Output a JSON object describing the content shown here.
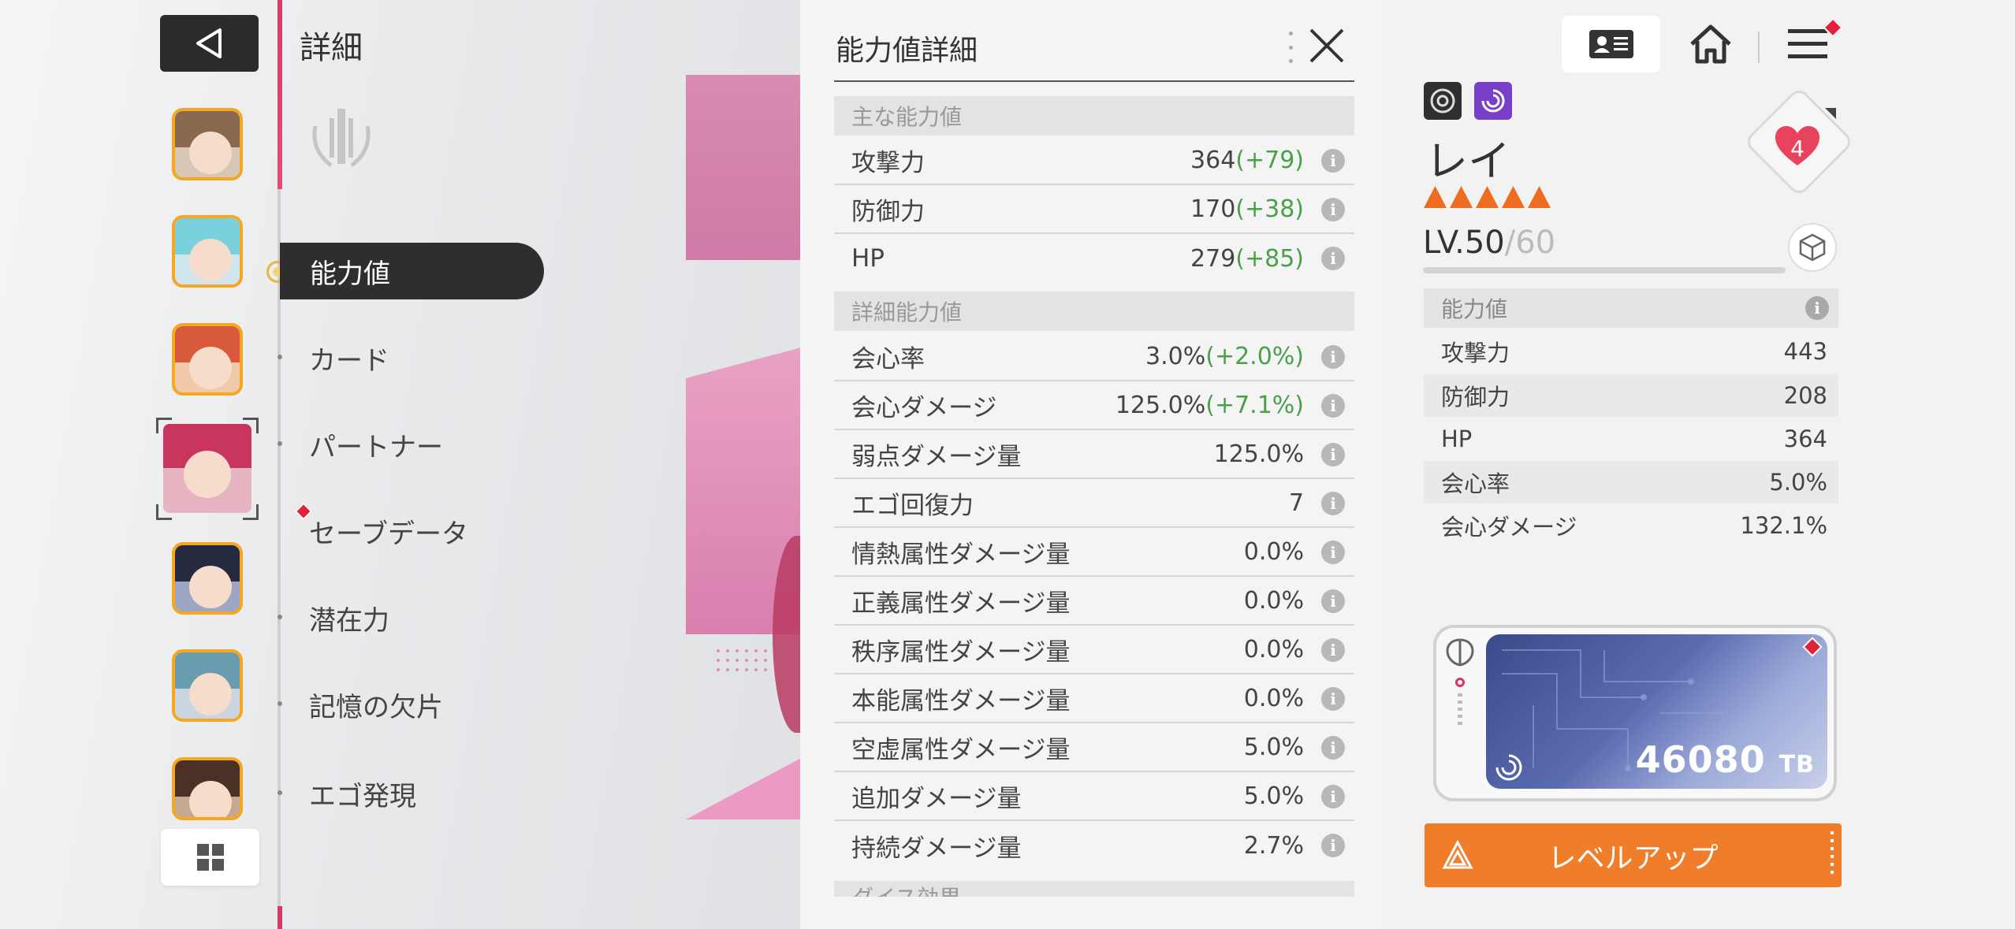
{
  "nav": {
    "title": "詳細",
    "menu": [
      {
        "label": "能力値",
        "active": true
      },
      {
        "label": "カード"
      },
      {
        "label": "パートナー"
      },
      {
        "label": "セーブデータ",
        "badge": "red-diamond"
      },
      {
        "label": "潜在力"
      },
      {
        "label": "記憶の欠片"
      },
      {
        "label": "エゴ発現"
      }
    ]
  },
  "panel": {
    "title": "能力値詳細",
    "main_section": "主な能力値",
    "main_stats": [
      {
        "label": "攻撃力",
        "value": "364",
        "bonus": "(+79)"
      },
      {
        "label": "防御力",
        "value": "170",
        "bonus": "(+38)"
      },
      {
        "label": "HP",
        "value": "279",
        "bonus": "(+85)"
      }
    ],
    "detail_section": "詳細能力値",
    "detail_stats": [
      {
        "label": "会心率",
        "value": "3.0%",
        "bonus": "(+2.0%)"
      },
      {
        "label": "会心ダメージ",
        "value": "125.0%",
        "bonus": "(+7.1%)"
      },
      {
        "label": "弱点ダメージ量",
        "value": "125.0%",
        "bonus": ""
      },
      {
        "label": "エゴ回復力",
        "value": "7",
        "bonus": ""
      },
      {
        "label": "情熱属性ダメージ量",
        "value": "0.0%",
        "bonus": ""
      },
      {
        "label": "正義属性ダメージ量",
        "value": "0.0%",
        "bonus": ""
      },
      {
        "label": "秩序属性ダメージ量",
        "value": "0.0%",
        "bonus": ""
      },
      {
        "label": "本能属性ダメージ量",
        "value": "0.0%",
        "bonus": ""
      },
      {
        "label": "空虚属性ダメージ量",
        "value": "5.0%",
        "bonus": ""
      },
      {
        "label": "追加ダメージ量",
        "value": "5.0%",
        "bonus": ""
      },
      {
        "label": "持続ダメージ量",
        "value": "2.7%",
        "bonus": ""
      }
    ],
    "info_glyph": "i",
    "cut_section": "ダイス効果"
  },
  "character": {
    "name": "レイ",
    "level_label": "LV.",
    "level": "50",
    "level_max": "/60",
    "affection": "4",
    "summary_head": "能力値",
    "summary": [
      {
        "label": "攻撃力",
        "value": "443"
      },
      {
        "label": "防御力",
        "value": "208"
      },
      {
        "label": "HP",
        "value": "364"
      },
      {
        "label": "会心率",
        "value": "5.0%"
      },
      {
        "label": "会心ダメージ",
        "value": "132.1%"
      }
    ],
    "tb_amount": "46080",
    "tb_unit": "TB",
    "levelup_label": "レベルアップ",
    "rarity_count": 5
  },
  "colors": {
    "accent": "#d83a6b",
    "bonus": "#4aa04a",
    "levelup": "#ef7d2a",
    "rarity": "#ee6c1f",
    "badge": "#e2223b"
  },
  "icons": [
    "back-arrow-icon",
    "grid-icon",
    "profile-card-icon",
    "home-icon",
    "hamburger-menu-icon",
    "close-icon",
    "info-icon",
    "heart-icon",
    "cube-icon",
    "brain-icon",
    "vortex-icon"
  ]
}
